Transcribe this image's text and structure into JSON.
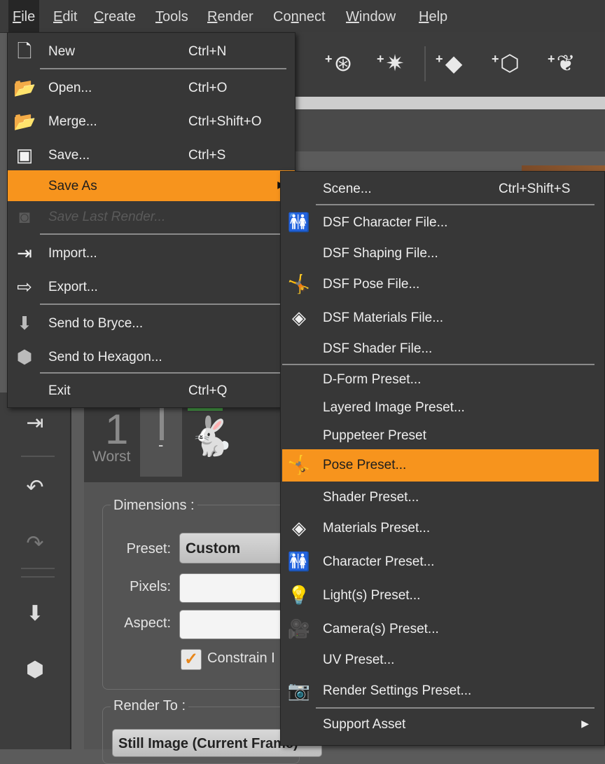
{
  "menubar": {
    "items": [
      {
        "label": "File",
        "accel": "F",
        "rest": "ile"
      },
      {
        "label": "Edit",
        "accel": "E",
        "rest": "dit"
      },
      {
        "label": "Create",
        "accel": "C",
        "rest": "reate"
      },
      {
        "label": "Tools",
        "accel": "T",
        "rest": "ools"
      },
      {
        "label": "Render",
        "accel": "R",
        "rest": "ender"
      },
      {
        "label": "Connect",
        "pre": "Co",
        "accel": "n",
        "rest": "nect"
      },
      {
        "label": "Window",
        "accel": "W",
        "rest": "indow"
      },
      {
        "label": "Help",
        "accel": "H",
        "rest": "elp"
      }
    ]
  },
  "file_menu": {
    "items": [
      {
        "label": "New",
        "shortcut": "Ctrl+N",
        "icon": "new-document-icon"
      },
      {
        "label": "Open...",
        "shortcut": "Ctrl+O",
        "icon": "open-folder-icon"
      },
      {
        "label": "Merge...",
        "shortcut": "Ctrl+Shift+O",
        "icon": "merge-folder-icon"
      },
      {
        "label": "Save...",
        "shortcut": "Ctrl+S",
        "icon": "save-disk-icon"
      },
      {
        "label": "Save As",
        "shortcut": "",
        "icon": "",
        "highlighted": true,
        "submenu": true
      },
      {
        "label": "Save Last Render...",
        "shortcut": "",
        "icon": "save-render-icon",
        "disabled": true
      },
      {
        "label": "Import...",
        "shortcut": "",
        "icon": "import-icon"
      },
      {
        "label": "Export...",
        "shortcut": "",
        "icon": "export-icon"
      },
      {
        "label": "Send to Bryce...",
        "shortcut": "",
        "icon": "bryce-icon"
      },
      {
        "label": "Send to Hexagon...",
        "shortcut": "",
        "icon": "hexagon-icon"
      },
      {
        "label": "Exit",
        "shortcut": "Ctrl+Q",
        "icon": ""
      }
    ]
  },
  "save_as_menu": {
    "items": [
      {
        "label": "Scene...",
        "shortcut": "Ctrl+Shift+S",
        "icon": ""
      },
      {
        "label": "DSF Character File...",
        "icon": "character-file-icon"
      },
      {
        "label": "DSF Shaping File...",
        "icon": ""
      },
      {
        "label": "DSF Pose File...",
        "icon": "pose-file-icon"
      },
      {
        "label": "DSF Materials File...",
        "icon": "materials-file-icon"
      },
      {
        "label": "DSF Shader File...",
        "icon": ""
      },
      {
        "label": "D-Form Preset...",
        "icon": ""
      },
      {
        "label": "Layered Image Preset...",
        "icon": ""
      },
      {
        "label": "Puppeteer Preset",
        "icon": ""
      },
      {
        "label": "Pose Preset...",
        "icon": "pose-preset-icon",
        "highlighted": true
      },
      {
        "label": "Shader Preset...",
        "icon": ""
      },
      {
        "label": "Materials Preset...",
        "icon": "materials-preset-icon"
      },
      {
        "label": "Character Preset...",
        "icon": "character-preset-icon"
      },
      {
        "label": "Light(s) Preset...",
        "icon": "light-preset-icon"
      },
      {
        "label": "Camera(s) Preset...",
        "icon": "camera-preset-icon"
      },
      {
        "label": "UV Preset...",
        "icon": ""
      },
      {
        "label": "Render Settings Preset...",
        "icon": "render-settings-icon"
      },
      {
        "label": "Support Asset",
        "icon": "",
        "submenu": true
      }
    ]
  },
  "render_pane": {
    "quality_number": "1",
    "quality_label": "Worst",
    "quality_dash": "-",
    "dimensions_title": "Dimensions :",
    "preset_label": "Preset:",
    "preset_value": "Custom",
    "pixels_label": "Pixels:",
    "aspect_label": "Aspect:",
    "constrain_label": "Constrain I",
    "render_to_title": "Render To :",
    "render_to_value": "Still Image (Current Frame)"
  },
  "colors": {
    "highlight": "#f7941d",
    "menu_bg": "#373737",
    "menubar_bg": "#3b3b3b"
  }
}
